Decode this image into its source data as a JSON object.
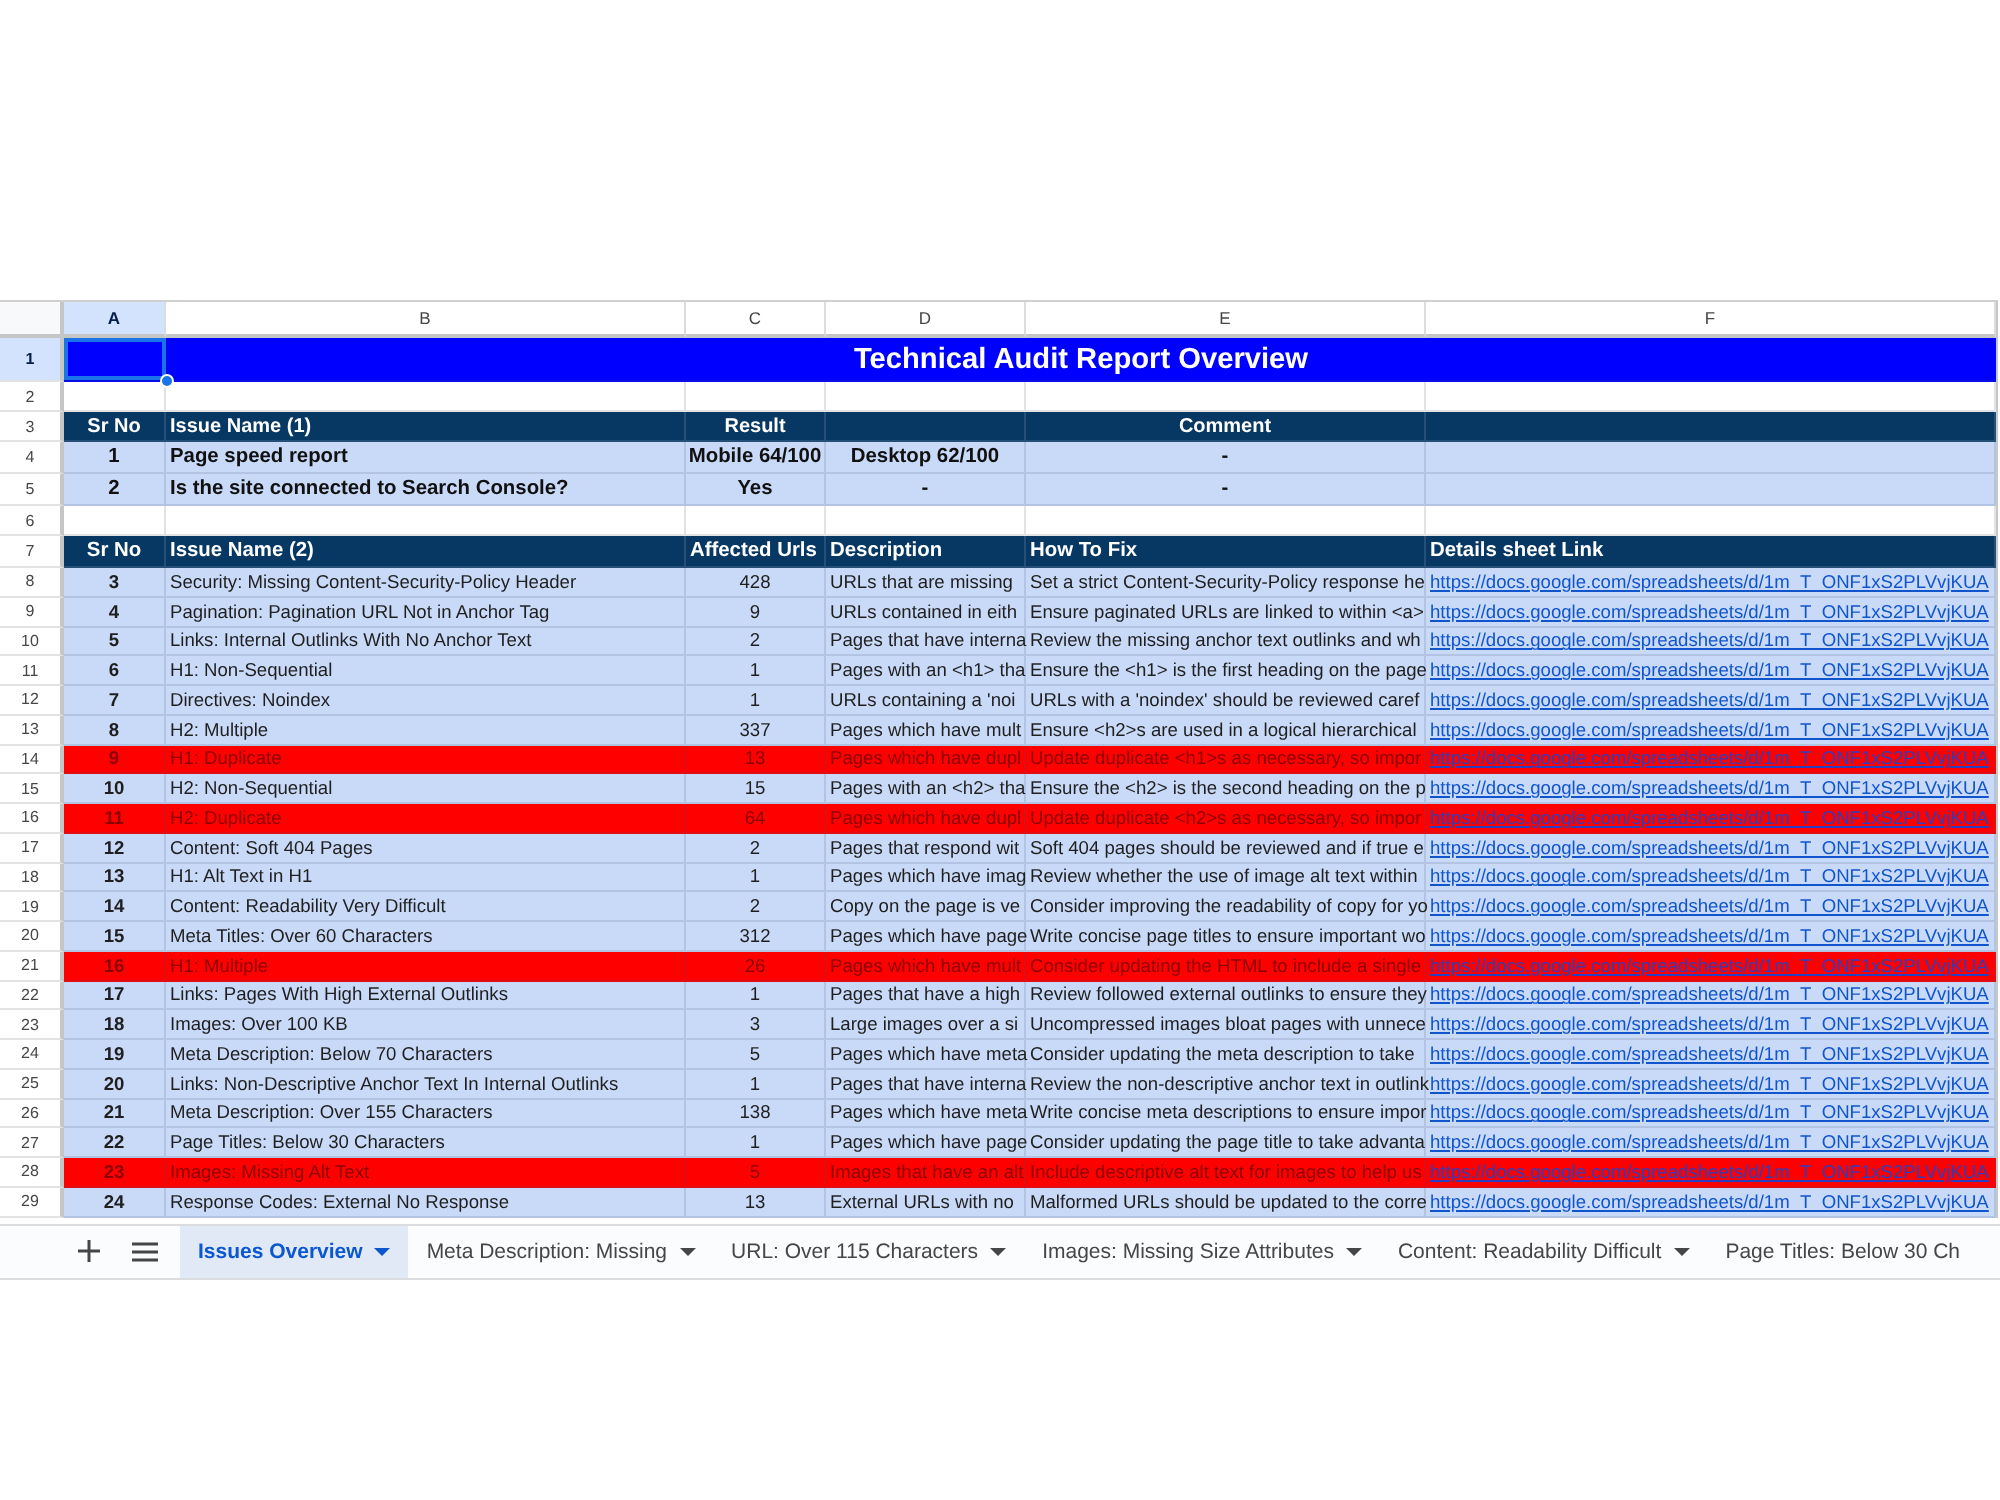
{
  "sheet": {
    "columns": [
      {
        "label": "A",
        "selected": true
      },
      {
        "label": "B",
        "selected": false
      },
      {
        "label": "C",
        "selected": false
      },
      {
        "label": "D",
        "selected": false
      },
      {
        "label": "E",
        "selected": false
      },
      {
        "label": "F",
        "selected": false
      }
    ],
    "title_row": {
      "row": "1",
      "selected": true,
      "title": "Technical Audit Report Overview"
    },
    "summary": {
      "spacer_row": {
        "row": "2",
        "selected": false
      },
      "header": {
        "row": "3",
        "selected": false,
        "sr_no": "Sr No",
        "issue_name": "Issue Name (1)",
        "result": "Result",
        "comment": "Comment"
      },
      "rows": [
        {
          "row": "4",
          "selected": false,
          "sr_no": "1",
          "issue_name": "Page speed report",
          "result": "Mobile 64/100",
          "column_d": "Desktop 62/100",
          "comment": "-"
        },
        {
          "row": "5",
          "selected": false,
          "sr_no": "2",
          "issue_name": "Is the site connected to Search Console?",
          "result": "Yes",
          "column_d": "-",
          "comment": "-"
        }
      ]
    },
    "issues": {
      "spacer_row": {
        "row": "6",
        "selected": false
      },
      "header": {
        "row": "7",
        "selected": false,
        "sr_no": "Sr No",
        "issue_name": "Issue Name (2)",
        "affected_urls": "Affected Urls",
        "description": "Description",
        "how_to_fix": "How To Fix",
        "details_link": "Details sheet Link"
      },
      "rows": [
        {
          "row": "8",
          "selected": false,
          "flagged": false,
          "sr_no": "3",
          "issue_name": "Security: Missing Content-Security-Policy Header",
          "affected_urls": "428",
          "description": "URLs that are missing",
          "how_to_fix": "Set a strict Content-Security-Policy response he",
          "details_link": "https://docs.google.com/spreadsheets/d/1m_T_ONF1xS2PLVvjKUA"
        },
        {
          "row": "9",
          "selected": false,
          "flagged": false,
          "sr_no": "4",
          "issue_name": "Pagination: Pagination URL Not in Anchor Tag",
          "affected_urls": "9",
          "description": "URLs contained in eith",
          "how_to_fix": "Ensure paginated URLs are linked to within <a>",
          "details_link": "https://docs.google.com/spreadsheets/d/1m_T_ONF1xS2PLVvjKUA"
        },
        {
          "row": "10",
          "selected": false,
          "flagged": false,
          "sr_no": "5",
          "issue_name": "Links: Internal Outlinks With No Anchor Text",
          "affected_urls": "2",
          "description": "Pages that have interna",
          "how_to_fix": "Review the missing anchor text outlinks and wh",
          "details_link": "https://docs.google.com/spreadsheets/d/1m_T_ONF1xS2PLVvjKUA"
        },
        {
          "row": "11",
          "selected": false,
          "flagged": false,
          "sr_no": "6",
          "issue_name": "H1: Non-Sequential",
          "affected_urls": "1",
          "description": "Pages with an <h1> tha",
          "how_to_fix": "Ensure the <h1> is the first heading on the page",
          "details_link": "https://docs.google.com/spreadsheets/d/1m_T_ONF1xS2PLVvjKUA"
        },
        {
          "row": "12",
          "selected": false,
          "flagged": false,
          "sr_no": "7",
          "issue_name": "Directives: Noindex",
          "affected_urls": "1",
          "description": "URLs containing a 'noi",
          "how_to_fix": "URLs with a 'noindex' should be reviewed caref",
          "details_link": "https://docs.google.com/spreadsheets/d/1m_T_ONF1xS2PLVvjKUA"
        },
        {
          "row": "13",
          "selected": false,
          "flagged": false,
          "sr_no": "8",
          "issue_name": "H2: Multiple",
          "affected_urls": "337",
          "description": "Pages which have mult",
          "how_to_fix": "Ensure <h2>s are used in a logical hierarchical",
          "details_link": "https://docs.google.com/spreadsheets/d/1m_T_ONF1xS2PLVvjKUA"
        },
        {
          "row": "14",
          "selected": false,
          "flagged": true,
          "sr_no": "9",
          "issue_name": "H1: Duplicate",
          "affected_urls": "13",
          "description": "Pages which have dupl",
          "how_to_fix": "Update duplicate <h1>s as necessary, so impor",
          "details_link": "https://docs.google.com/spreadsheets/d/1m_T_ONF1xS2PLVvjKUA"
        },
        {
          "row": "15",
          "selected": false,
          "flagged": false,
          "sr_no": "10",
          "issue_name": "H2: Non-Sequential",
          "affected_urls": "15",
          "description": "Pages with an <h2> tha",
          "how_to_fix": "Ensure the <h2> is the second heading on the p",
          "details_link": "https://docs.google.com/spreadsheets/d/1m_T_ONF1xS2PLVvjKUA"
        },
        {
          "row": "16",
          "selected": false,
          "flagged": true,
          "sr_no": "11",
          "issue_name": "H2: Duplicate",
          "affected_urls": "64",
          "description": "Pages which have dupl",
          "how_to_fix": "Update duplicate <h2>s as necessary, so impor",
          "details_link": "https://docs.google.com/spreadsheets/d/1m_T_ONF1xS2PLVvjKUA"
        },
        {
          "row": "17",
          "selected": false,
          "flagged": false,
          "sr_no": "12",
          "issue_name": "Content: Soft 404 Pages",
          "affected_urls": "2",
          "description": "Pages that respond wit",
          "how_to_fix": "Soft 404 pages should be reviewed and if true e",
          "details_link": "https://docs.google.com/spreadsheets/d/1m_T_ONF1xS2PLVvjKUA"
        },
        {
          "row": "18",
          "selected": false,
          "flagged": false,
          "sr_no": "13",
          "issue_name": "H1: Alt Text in H1",
          "affected_urls": "1",
          "description": "Pages which have imag",
          "how_to_fix": "Review whether the use of image alt text within",
          "details_link": "https://docs.google.com/spreadsheets/d/1m_T_ONF1xS2PLVvjKUA"
        },
        {
          "row": "19",
          "selected": false,
          "flagged": false,
          "sr_no": "14",
          "issue_name": "Content: Readability Very Difficult",
          "affected_urls": "2",
          "description": "Copy on the page is ve",
          "how_to_fix": "Consider improving the readability of copy for yo",
          "details_link": "https://docs.google.com/spreadsheets/d/1m_T_ONF1xS2PLVvjKUA"
        },
        {
          "row": "20",
          "selected": false,
          "flagged": false,
          "sr_no": "15",
          "issue_name": "Meta Titles: Over 60 Characters",
          "affected_urls": "312",
          "description": "Pages which have page",
          "how_to_fix": "Write concise page titles to ensure important wo",
          "details_link": "https://docs.google.com/spreadsheets/d/1m_T_ONF1xS2PLVvjKUA"
        },
        {
          "row": "21",
          "selected": false,
          "flagged": true,
          "sr_no": "16",
          "issue_name": "H1: Multiple",
          "affected_urls": "26",
          "description": "Pages which have mult",
          "how_to_fix": "Consider updating the HTML to include a single",
          "details_link": "https://docs.google.com/spreadsheets/d/1m_T_ONF1xS2PLVvjKUA"
        },
        {
          "row": "22",
          "selected": false,
          "flagged": false,
          "sr_no": "17",
          "issue_name": "Links: Pages With High External Outlinks",
          "affected_urls": "1",
          "description": "Pages that have a high",
          "how_to_fix": "Review followed external outlinks to ensure they",
          "details_link": "https://docs.google.com/spreadsheets/d/1m_T_ONF1xS2PLVvjKUA"
        },
        {
          "row": "23",
          "selected": false,
          "flagged": false,
          "sr_no": "18",
          "issue_name": "Images: Over 100 KB",
          "affected_urls": "3",
          "description": "Large images over a si",
          "how_to_fix": "Uncompressed images bloat pages with unnece",
          "details_link": "https://docs.google.com/spreadsheets/d/1m_T_ONF1xS2PLVvjKUA"
        },
        {
          "row": "24",
          "selected": false,
          "flagged": false,
          "sr_no": "19",
          "issue_name": "Meta Description: Below 70 Characters",
          "affected_urls": "5",
          "description": "Pages which have meta",
          "how_to_fix": "Consider updating the meta description to take",
          "details_link": "https://docs.google.com/spreadsheets/d/1m_T_ONF1xS2PLVvjKUA"
        },
        {
          "row": "25",
          "selected": false,
          "flagged": false,
          "sr_no": "20",
          "issue_name": "Links: Non-Descriptive Anchor Text In Internal Outlinks",
          "affected_urls": "1",
          "description": "Pages that have interna",
          "how_to_fix": "Review the non-descriptive anchor text in outlink",
          "details_link": "https://docs.google.com/spreadsheets/d/1m_T_ONF1xS2PLVvjKUA"
        },
        {
          "row": "26",
          "selected": false,
          "flagged": false,
          "sr_no": "21",
          "issue_name": "Meta Description: Over 155 Characters",
          "affected_urls": "138",
          "description": "Pages which have meta",
          "how_to_fix": "Write concise meta descriptions to ensure impor",
          "details_link": "https://docs.google.com/spreadsheets/d/1m_T_ONF1xS2PLVvjKUA"
        },
        {
          "row": "27",
          "selected": false,
          "flagged": false,
          "sr_no": "22",
          "issue_name": "Page Titles: Below 30 Characters",
          "affected_urls": "1",
          "description": "Pages which have page",
          "how_to_fix": "Consider updating the page title to take advanta",
          "details_link": "https://docs.google.com/spreadsheets/d/1m_T_ONF1xS2PLVvjKUA"
        },
        {
          "row": "28",
          "selected": false,
          "flagged": true,
          "sr_no": "23",
          "issue_name": "Images: Missing Alt Text",
          "affected_urls": "5",
          "description": "Images that have an alt",
          "how_to_fix": "Include descriptive alt text for images to help us",
          "details_link": "https://docs.google.com/spreadsheets/d/1m_T_ONF1xS2PLVvjKUA"
        },
        {
          "row": "29",
          "selected": false,
          "flagged": false,
          "sr_no": "24",
          "issue_name": "Response Codes: External No Response",
          "affected_urls": "13",
          "description": "External URLs with no",
          "how_to_fix": "Malformed URLs should be updated to the corre",
          "details_link": "https://docs.google.com/spreadsheets/d/1m_T_ONF1xS2PLVvjKUA"
        }
      ]
    }
  },
  "tabs": [
    {
      "label": "Issues Overview",
      "selected": true,
      "dropdown": true
    },
    {
      "label": "Meta Description: Missing",
      "selected": false,
      "dropdown": true
    },
    {
      "label": "URL: Over 115 Characters",
      "selected": false,
      "dropdown": true
    },
    {
      "label": "Images: Missing Size Attributes",
      "selected": false,
      "dropdown": true
    },
    {
      "label": "Content: Readability Difficult",
      "selected": false,
      "dropdown": true
    },
    {
      "label": "Page Titles: Below 30 Ch",
      "selected": false,
      "dropdown": false
    }
  ]
}
